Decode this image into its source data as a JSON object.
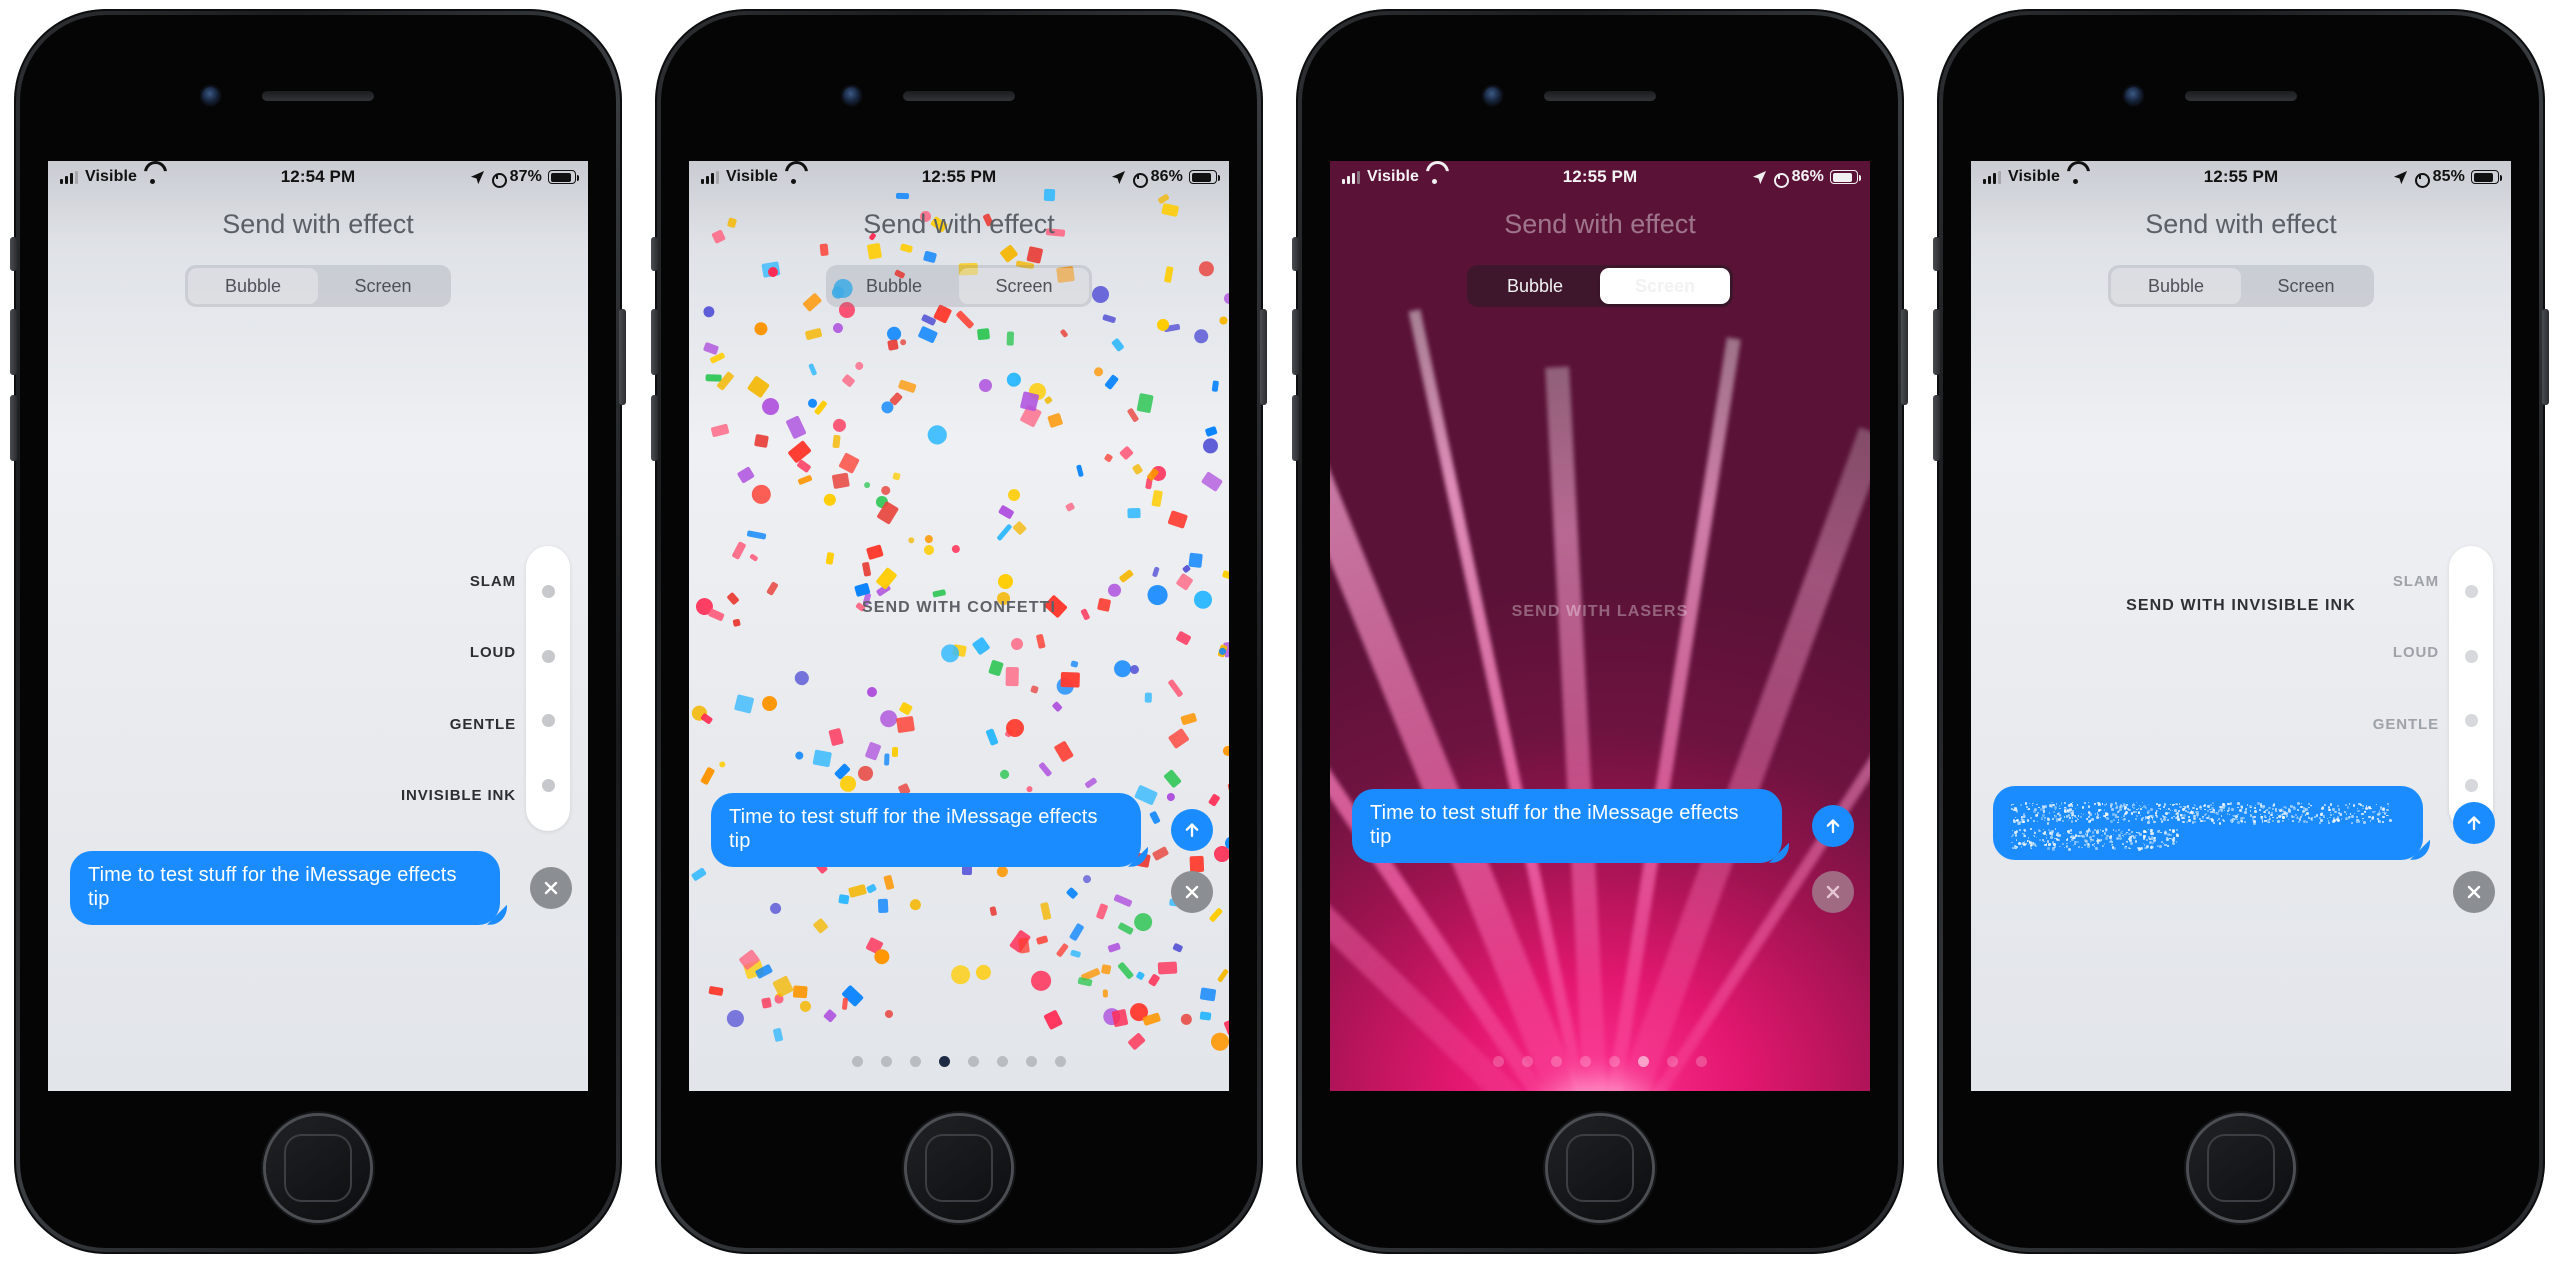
{
  "page": {
    "title": "iMessage Send with effect — four iPhone screenshots",
    "background": "#ffffff"
  },
  "common": {
    "carrier": "Visible",
    "sheet_title": "Send with effect",
    "segment": {
      "bubble": "Bubble",
      "screen": "Screen"
    },
    "message_text": "Time to test stuff for the iMessage effects tip",
    "bubble_color": "#1a8cff",
    "bubble_effects": [
      "SLAM",
      "LOUD",
      "GENTLE",
      "INVISIBLE INK"
    ],
    "icons": {
      "signal": "signal-bars-icon",
      "wifi": "wifi-icon",
      "location": "location-arrow-icon",
      "alarm": "alarm-clock-icon",
      "battery": "battery-icon",
      "send": "send-arrow-up-icon",
      "close": "close-x-icon"
    }
  },
  "phones": [
    {
      "id": "phone-1-bubble-effects",
      "status": {
        "time": "12:54 PM",
        "battery_percent": "87%"
      },
      "theme": "light",
      "selected_tab": "Bubble",
      "effect_caption": null,
      "message_hidden": false,
      "has_send_button": false,
      "page_dots": null
    },
    {
      "id": "phone-2-confetti",
      "status": {
        "time": "12:55 PM",
        "battery_percent": "86%"
      },
      "theme": "light",
      "selected_tab": "Screen",
      "effect_caption": "SEND WITH CONFETTI",
      "message_hidden": false,
      "has_send_button": true,
      "page_dots": {
        "count": 8,
        "active_index": 3
      }
    },
    {
      "id": "phone-3-lasers",
      "status": {
        "time": "12:55 PM",
        "battery_percent": "86%"
      },
      "theme": "dark",
      "selected_tab": "Screen",
      "effect_caption": "SEND WITH LASERS",
      "message_hidden": false,
      "has_send_button": true,
      "page_dots": {
        "count": 8,
        "active_index": 5
      }
    },
    {
      "id": "phone-4-invisible-ink",
      "status": {
        "time": "12:55 PM",
        "battery_percent": "85%"
      },
      "theme": "light",
      "selected_tab": "Bubble",
      "effect_caption": "SEND WITH INVISIBLE INK",
      "message_hidden": true,
      "has_send_button": true,
      "page_dots": null
    }
  ]
}
